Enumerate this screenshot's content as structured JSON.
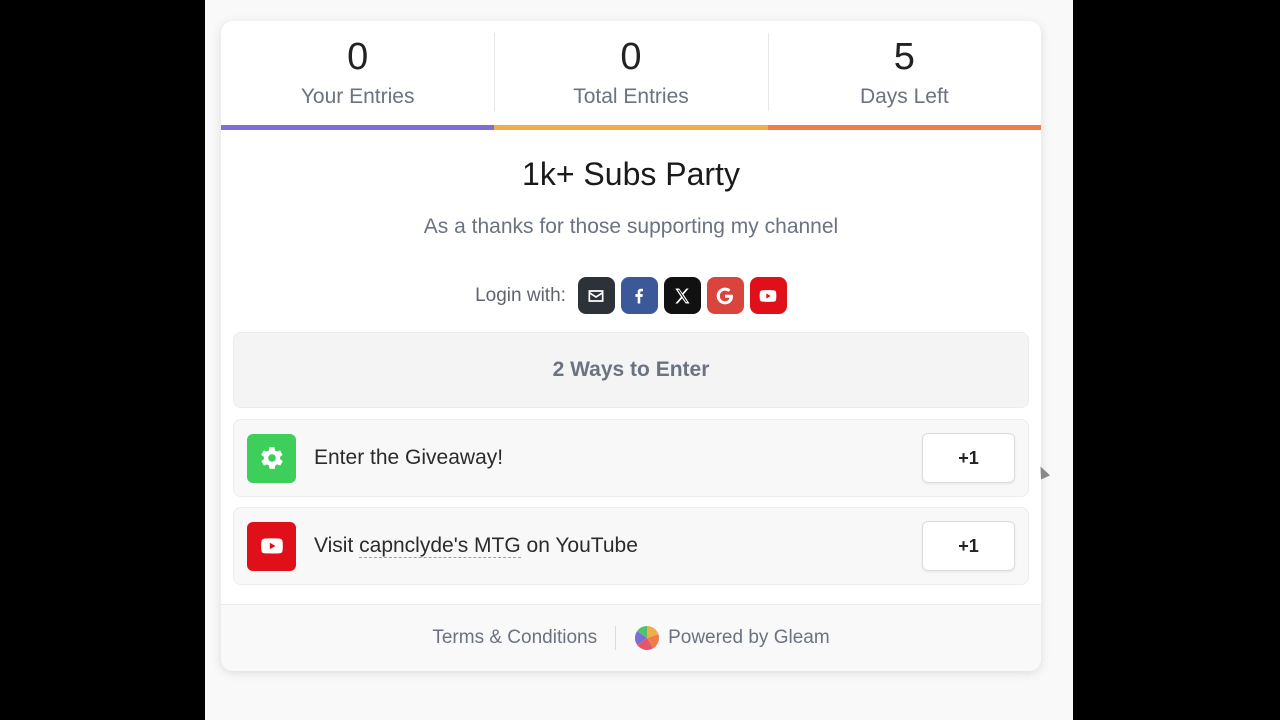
{
  "stats": [
    {
      "value": "0",
      "label": "Your Entries",
      "color": "#7b6fd6"
    },
    {
      "value": "0",
      "label": "Total Entries",
      "color": "#f2ad4a"
    },
    {
      "value": "5",
      "label": "Days Left",
      "color": "#f07c47"
    }
  ],
  "campaign": {
    "title": "1k+ Subs Party",
    "subtitle": "As a thanks for those supporting my channel"
  },
  "login": {
    "label": "Login with:",
    "providers": [
      {
        "name": "email",
        "icon": "envelope-icon",
        "color": "#2d3138"
      },
      {
        "name": "facebook",
        "icon": "facebook-icon",
        "color": "#3b5998"
      },
      {
        "name": "x",
        "icon": "x-icon",
        "color": "#111111"
      },
      {
        "name": "google",
        "icon": "google-icon",
        "color": "#d9453c"
      },
      {
        "name": "youtube",
        "icon": "youtube-icon",
        "color": "#e0101a"
      }
    ]
  },
  "ways": {
    "label": "2 Ways to Enter"
  },
  "entries": [
    {
      "prefix": "Enter the Giveaway!",
      "link": "",
      "suffix": "",
      "points": "+1",
      "icon": "gear-icon",
      "icon_color": "#3ecf5a"
    },
    {
      "prefix": "Visit ",
      "link": "capnclyde's MTG",
      "suffix": " on YouTube",
      "points": "+1",
      "icon": "youtube-icon",
      "icon_color": "#e0101a"
    }
  ],
  "footer": {
    "terms": "Terms & Conditions",
    "powered": "Powered by Gleam"
  }
}
